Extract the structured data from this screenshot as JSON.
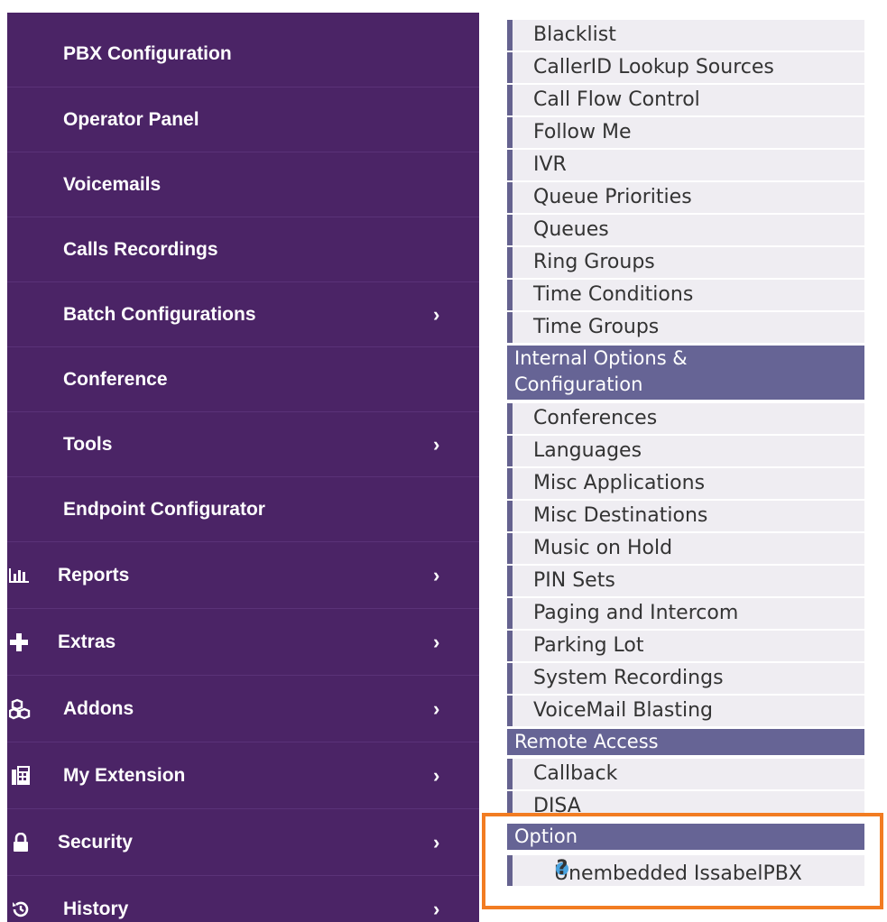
{
  "sidebar": {
    "items": [
      {
        "label": "PBX Configuration",
        "chevron": ""
      },
      {
        "label": "Operator Panel",
        "chevron": ""
      },
      {
        "label": "Voicemails",
        "chevron": ""
      },
      {
        "label": "Calls Recordings",
        "chevron": ""
      },
      {
        "label": "Batch Configurations",
        "chevron": "›"
      },
      {
        "label": "Conference",
        "chevron": ""
      },
      {
        "label": "Tools",
        "chevron": "›"
      },
      {
        "label": "Endpoint Configurator",
        "chevron": ""
      }
    ],
    "top_items": [
      {
        "label": "Reports",
        "icon": "bar-chart-icon",
        "chevron": "›"
      },
      {
        "label": "Extras",
        "icon": "plus-icon",
        "chevron": "›"
      },
      {
        "label": "Addons",
        "icon": "cubes-icon",
        "chevron": "›"
      },
      {
        "label": "My Extension",
        "icon": "fax-icon",
        "chevron": "›"
      },
      {
        "label": "Security",
        "icon": "lock-icon",
        "chevron": "›"
      },
      {
        "label": "History",
        "icon": "history-icon",
        "chevron": "›"
      }
    ],
    "background": "#4b2466"
  },
  "menu": {
    "applications": [
      "Blacklist",
      "CallerID Lookup Sources",
      "Call Flow Control",
      "Follow Me",
      "IVR",
      "Queue Priorities",
      "Queues",
      "Ring Groups",
      "Time Conditions",
      "Time Groups"
    ],
    "internal_header": "Internal Options & Configuration",
    "internal_header_line1": "Internal Options &",
    "internal_header_line2": "Configuration",
    "internal": [
      "Conferences",
      "Languages",
      "Misc Applications",
      "Misc Destinations",
      "Music on Hold",
      "PIN Sets",
      "Paging and Intercom",
      "Parking Lot",
      "System Recordings",
      "VoiceMail Blasting"
    ],
    "remote_header": "Remote Access",
    "remote": [
      "Callback",
      "DISA"
    ],
    "option_header": "Option",
    "option": [
      "Unembedded IssabelPBX"
    ],
    "help_icon_glyph": "?",
    "header_color": "#666495",
    "highlight_color": "#f27c22"
  }
}
